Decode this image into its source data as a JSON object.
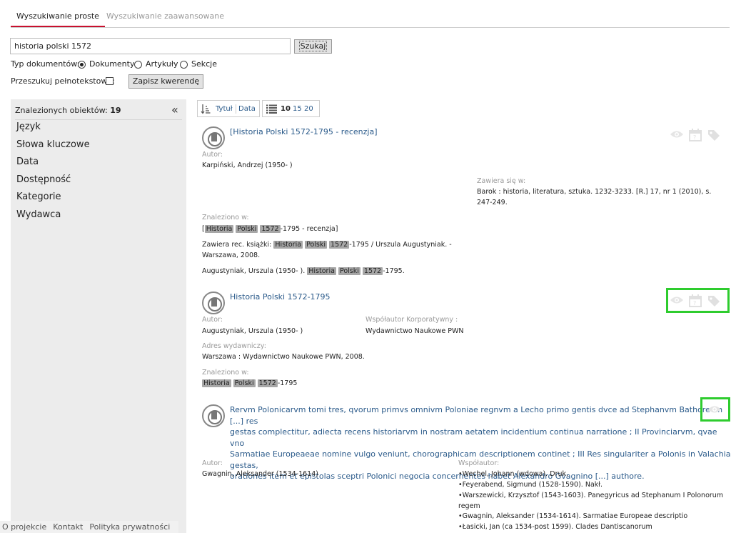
{
  "tabs": {
    "simple": "Wyszukiwanie proste",
    "advanced": "Wyszukiwanie zaawansowane"
  },
  "search": {
    "value": "historia polski 1572",
    "button": "Szukaj",
    "save_button": "Zapisz kwerendę"
  },
  "doc_type": {
    "label": "Typ dokumentów:",
    "options": [
      "Dokumenty",
      "Artykuły",
      "Sekcje"
    ],
    "selected": "Dokumenty"
  },
  "fulltext": {
    "label": "Przeszukuj pełnotekstowo:"
  },
  "sidebar": {
    "found_label": "Znalezionych obiektów:",
    "found_count": "19",
    "collapse": "«",
    "facets": [
      "Język",
      "Słowa kluczowe",
      "Data",
      "Dostępność",
      "Kategorie",
      "Wydawca"
    ]
  },
  "toolbar": {
    "sort_title": "Tytuł",
    "sort_date": "Data",
    "page_sizes": [
      "10",
      "15",
      "20"
    ],
    "page_size_selected": "10"
  },
  "results": [
    {
      "title": "[Historia Polski 1572-1795 - recenzja]",
      "author_label": "Autor:",
      "author": "Karpiński, Andrzej (1950- )",
      "contained_label": "Zawiera się w:",
      "contained_line1": "Barok : historia, literatura, sztuka. 1232-3233. [R.] 17, nr 1 (2010), s.",
      "contained_line2": "247-249.",
      "found_label": "Znaleziono w:",
      "found1_post": "-1795 - recenzja]",
      "found2_pre": "Zawiera rec. książki:",
      "found2_post": "-1795 / Urszula Augustyniak. -",
      "found2_line2": "Warszawa, 2008.",
      "found3_pre": "Augustyniak, Urszula (1950- ).",
      "found3_post": "-1795."
    },
    {
      "title": "Historia Polski 1572-1795",
      "author_label": "Autor:",
      "author": "Augustyniak, Urszula (1950- )",
      "corp_label": "Współautor Korporatywny :",
      "corp": "Wydawnictwo Naukowe PWN",
      "address_label": "Adres wydawniczy:",
      "address": "Warszawa : Wydawnictwo Naukowe PWN, 2008.",
      "found_label": "Znaleziono w:",
      "found1_post": "-1795"
    },
    {
      "title_lines": [
        "Rervm Polonicarvm tomi tres, qvorum primvs omnivm Poloniae regnvm a Lecho primo gentis dvce ad Stephanvm Bathorevm [...] res",
        "gestas complectitur, adiecta recens historiarvm in nostram aetatem incidentium continua narratione ; II Provinciarvm, qvae vno",
        "Sarmatiae Europeaeae nomine vulgo veniunt, chorographicam descriptionem continet ; III Res singulariter a Polonis in Valachia gestas,",
        "orationes item et epistolas sceptri Polonici negocia concernentes habet Alexandro Gvagnino [...] authore."
      ],
      "author_label": "Autor:",
      "author": "Gwagnin, Aleksander (1534-1614)",
      "coauthor_label": "Współautor:",
      "coauthors": [
        "•Wechel, Johann (wdowa). Druk.",
        "•Feyerabend, Sigmund (1528-1590). Nakł.",
        "•Warszewicki, Krzysztof (1543-1603). Panegyricus ad Stephanum I Polonorum",
        "regem",
        "•Gwagnin, Aleksander (1534-1614). Sarmatiae Europeae descriptio",
        "•Łasicki, Jan (ca 1534-post 1599). Clades Dantiscanorum"
      ]
    }
  ],
  "highlights": {
    "w1": "Historia",
    "w2": "Polski",
    "w3": "1572"
  },
  "footer": [
    "O projekcie",
    "Kontakt",
    "Polityka prywatności"
  ],
  "colors": {
    "accent": "#c8102e",
    "link": "#2a5a8a",
    "highlight": "#a7a7a7",
    "annotation": "#2ecc2e",
    "sidebar_bg": "#ececec"
  }
}
